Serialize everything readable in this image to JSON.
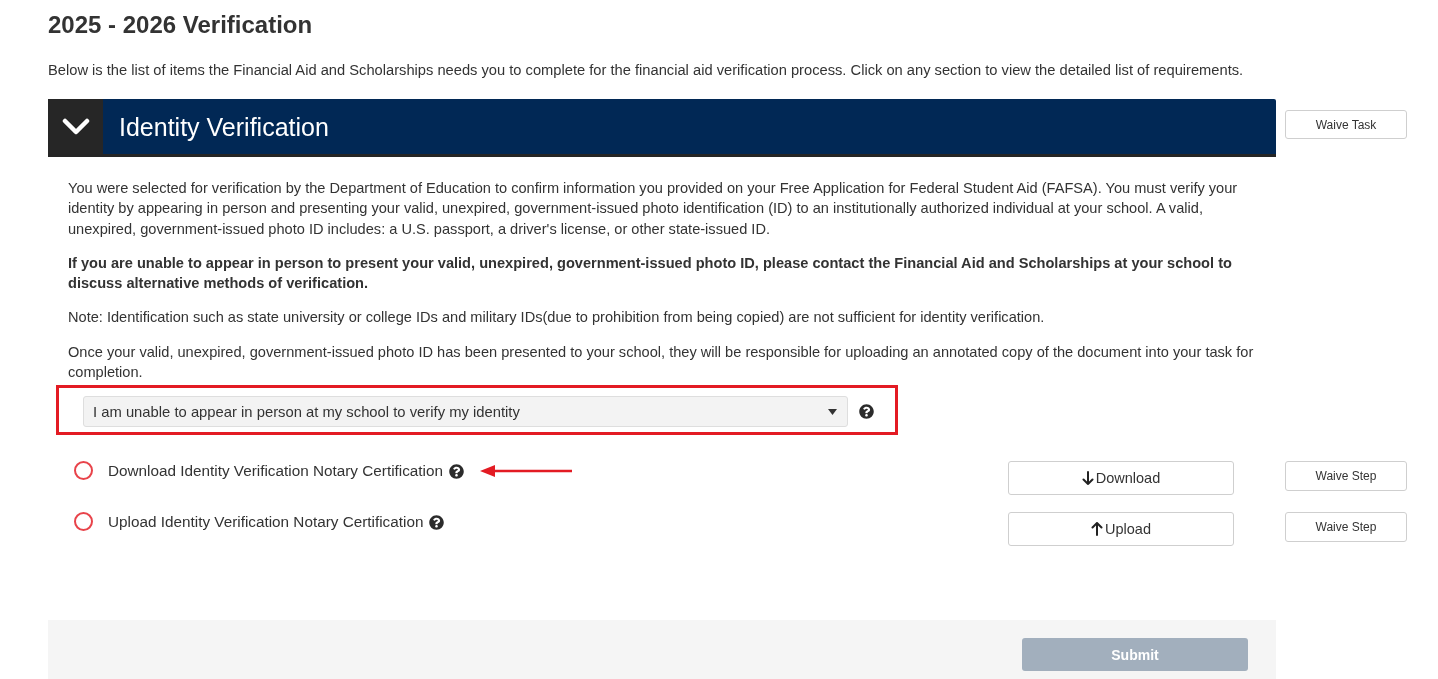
{
  "page": {
    "title": "2025 - 2026 Verification",
    "intro": "Below is the list of items the Financial Aid and Scholarships needs you to complete for the financial aid verification process. Click on any section to view the detailed list of requirements."
  },
  "task": {
    "title": "Identity Verification",
    "expanded": true,
    "waive_button": "Waive Task",
    "paragraphs": [
      {
        "text": "You were selected for verification by the Department of Education to confirm information you provided on your Free Application for Federal Student Aid (FAFSA). You must verify your identity by appearing in person and presenting your valid, unexpired, government-issued photo identification (ID) to an institutionally authorized individual at your school. A valid, unexpired, government-issued photo ID includes: a U.S. passport, a driver's license, or other state-issued ID.",
        "bold": false
      },
      {
        "text": "If you are unable to appear in person to present your valid, unexpired, government-issued photo ID, please contact the Financial Aid and Scholarships at your school to discuss alternative methods of verification.",
        "bold": true
      },
      {
        "text": "Note: Identification such as state university or college IDs and military IDs(due to prohibition from being copied) are not sufficient for identity verification.",
        "bold": false
      },
      {
        "text": "Once your valid, unexpired, government-issued photo ID has been presented to your school, they will be responsible for uploading an annotated copy of the document into your task for completion.",
        "bold": false
      }
    ],
    "dropdown": {
      "value": "I am unable to appear in person at my school to verify my identity",
      "highlighted": true
    },
    "steps": [
      {
        "label": "Download Identity Verification Notary Certification",
        "completed": false,
        "annotation_arrow": true,
        "action": {
          "kind": "download",
          "label": "Download"
        },
        "waive_button": "Waive Step"
      },
      {
        "label": "Upload Identity Verification Notary Certification",
        "completed": false,
        "annotation_arrow": false,
        "action": {
          "kind": "upload",
          "label": "Upload"
        },
        "waive_button": "Waive Step"
      }
    ]
  },
  "footer": {
    "submit": {
      "label": "Submit",
      "disabled": true
    }
  }
}
